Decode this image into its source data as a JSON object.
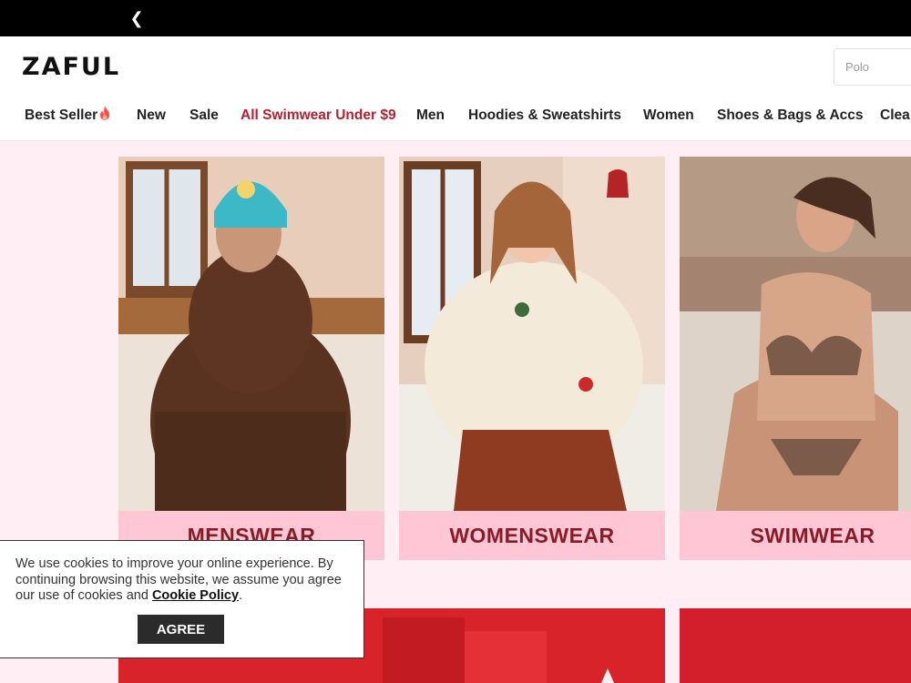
{
  "topbar": {
    "back_icon": "chevron-left-icon"
  },
  "header": {
    "logo": "ZAFUL",
    "search_placeholder": "Polo"
  },
  "nav": {
    "items": [
      {
        "label": "Best Seller",
        "icon": "flame-icon"
      },
      {
        "label": "New"
      },
      {
        "label": "Sale"
      },
      {
        "label": "All Swimwear Under $9",
        "color": "#b3202e"
      },
      {
        "label": "Men"
      },
      {
        "label": "Hoodies & Sweatshirts"
      },
      {
        "label": "Women"
      },
      {
        "label": "Shoes & Bags & Accs"
      },
      {
        "label": "Clea"
      }
    ]
  },
  "categories": [
    {
      "label": "MENSWEAR"
    },
    {
      "label": "WOMENSWEAR"
    },
    {
      "label": "SWIMWEAR"
    }
  ],
  "cookie": {
    "text": "We use cookies to improve your online experience. By continuing browsing this website, we assume you agree our use of cookies and ",
    "link": "Cookie Policy",
    "end": ".",
    "button": "AGREE"
  },
  "colors": {
    "accent": "#b3202e",
    "label": "#8a1a24",
    "card_bg": "#ffc7d6",
    "page_bg": "#ffeef4"
  }
}
